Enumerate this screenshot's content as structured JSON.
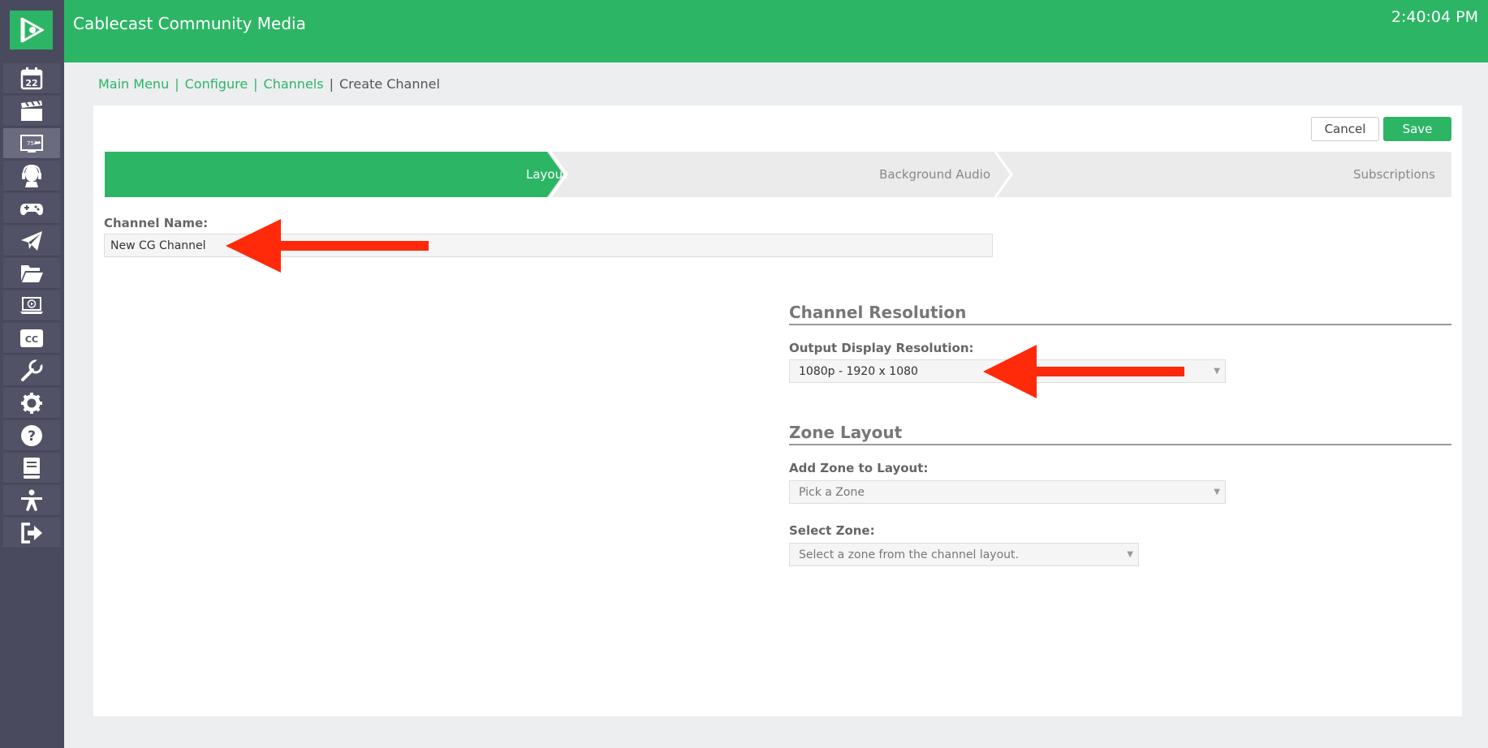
{
  "header": {
    "app_title": "Cablecast Community Media",
    "clock": "2:40:04 PM"
  },
  "sidebar": {
    "calendar_day": "22",
    "monitor_text": "75°"
  },
  "breadcrumb": {
    "items": [
      "Main Menu",
      "Configure",
      "Channels"
    ],
    "current": "Create Channel",
    "separator": "|"
  },
  "actions": {
    "cancel_label": "Cancel",
    "save_label": "Save"
  },
  "steps": [
    "Layout",
    "Background Audio",
    "Subscriptions"
  ],
  "form": {
    "channel_name_label": "Channel Name:",
    "channel_name_value": "New CG Channel",
    "resolution_section_title": "Channel Resolution",
    "output_resolution_label": "Output Display Resolution:",
    "output_resolution_value": "1080p - 1920 x 1080",
    "zone_section_title": "Zone Layout",
    "add_zone_label": "Add Zone to Layout:",
    "add_zone_placeholder": "Pick a Zone",
    "select_zone_label": "Select Zone:",
    "select_zone_placeholder": "Select a zone from the channel layout."
  },
  "colors": {
    "brand_green": "#2db566",
    "sidebar": "#4a4a5e",
    "annotation_arrow": "#ff2a0a"
  }
}
